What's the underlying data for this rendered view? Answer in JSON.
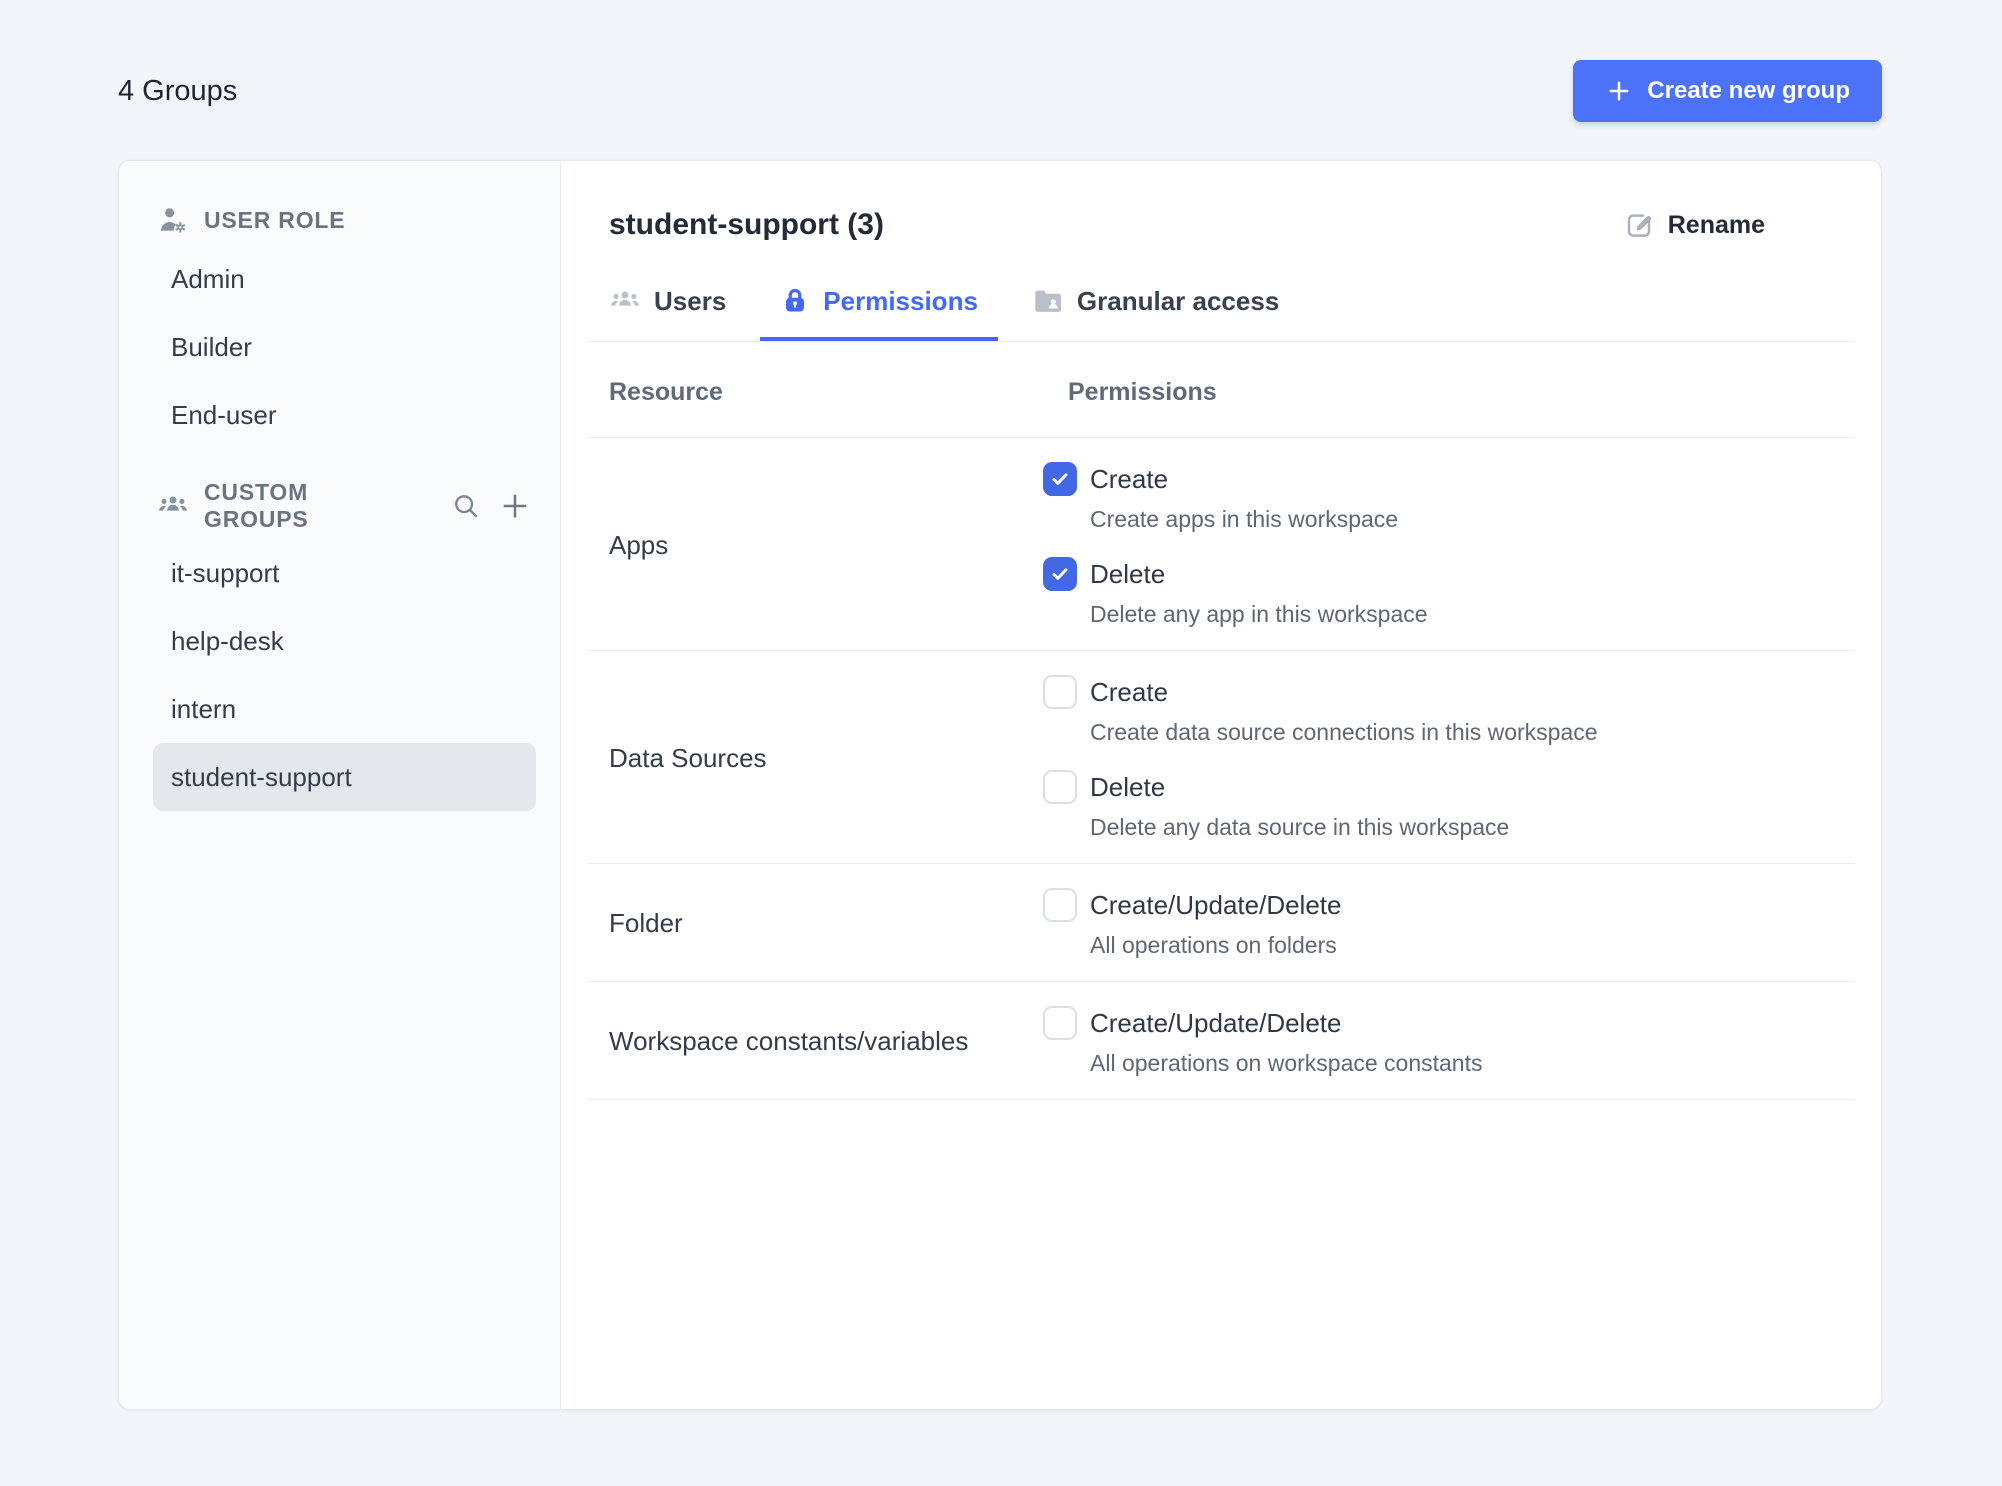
{
  "colors": {
    "page_bg": "#F2F5F9",
    "accent_button": "#4D72FA",
    "tab_active": "#4368FA",
    "checkbox_checked": "#4368E3",
    "selected_item_bg": "#E4E8EC"
  },
  "header": {
    "title": "4 Groups",
    "create_button_label": "Create new group"
  },
  "sidebar": {
    "user_role": {
      "label": "USER ROLE",
      "items": [
        "Admin",
        "Builder",
        "End-user"
      ]
    },
    "custom_groups": {
      "label": "CUSTOM GROUPS",
      "items": [
        {
          "label": "it-support",
          "selected": false
        },
        {
          "label": "help-desk",
          "selected": false
        },
        {
          "label": "intern",
          "selected": false
        },
        {
          "label": "student-support",
          "selected": true
        }
      ]
    }
  },
  "panel": {
    "title": "student-support (3)",
    "rename_label": "Rename",
    "tabs": [
      {
        "label": "Users",
        "icon": "users-icon",
        "active": false
      },
      {
        "label": "Permissions",
        "icon": "lock-icon",
        "active": true
      },
      {
        "label": "Granular access",
        "icon": "folder-user-icon",
        "active": false
      }
    ],
    "table": {
      "resource_header": "Resource",
      "permissions_header": "Permissions",
      "rows": [
        {
          "resource": "Apps",
          "permissions": [
            {
              "label": "Create",
              "description": "Create apps in this workspace",
              "checked": true
            },
            {
              "label": "Delete",
              "description": "Delete any app in this workspace",
              "checked": true
            }
          ]
        },
        {
          "resource": "Data Sources",
          "permissions": [
            {
              "label": "Create",
              "description": "Create data source connections in this workspace",
              "checked": false
            },
            {
              "label": "Delete",
              "description": "Delete any data source in this workspace",
              "checked": false
            }
          ]
        },
        {
          "resource": "Folder",
          "permissions": [
            {
              "label": "Create/Update/Delete",
              "description": "All operations on folders",
              "checked": false
            }
          ]
        },
        {
          "resource": "Workspace constants/variables",
          "permissions": [
            {
              "label": "Create/Update/Delete",
              "description": "All operations on workspace constants",
              "checked": false
            }
          ]
        }
      ]
    }
  },
  "icons": {
    "create_button": "plus-icon",
    "user_role_header": "user-gear-icon",
    "custom_groups_header": "people-group-icon",
    "custom_groups_actions": [
      "search-icon",
      "plus-icon"
    ],
    "tabs": [
      "users-icon",
      "lock-icon",
      "folder-user-icon"
    ],
    "rename": "edit-pencil-icon",
    "checkbox": "checkmark-icon"
  }
}
